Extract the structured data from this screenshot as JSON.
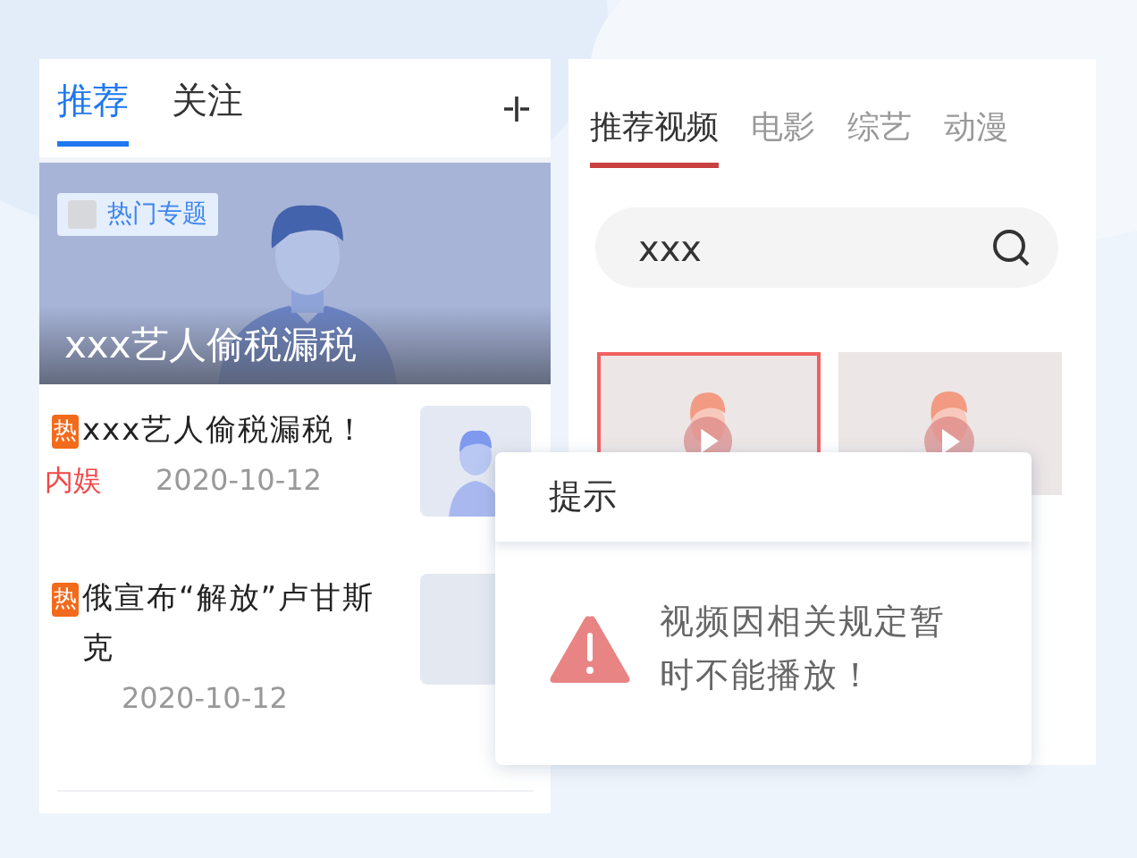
{
  "left_panel": {
    "tabs": [
      {
        "label": "推荐",
        "selected": true
      },
      {
        "label": "关注",
        "selected": false
      }
    ],
    "banner": {
      "tag": "热门专题",
      "title": "xxx艺人偷税漏税"
    },
    "news": [
      {
        "badge": "热",
        "title": "xxx艺人偷税漏税！",
        "category": "内娱",
        "date": "2020-10-12"
      },
      {
        "badge": "热",
        "title": "俄宣布“解放”卢甘斯克",
        "date": "2020-10-12",
        "thumbnail": {
          "kind": "blank"
        }
      }
    ]
  },
  "right_panel": {
    "tabs": [
      {
        "label": "推荐视频",
        "selected": true
      },
      {
        "label": "电影",
        "selected": false
      },
      {
        "label": "综艺",
        "selected": false
      },
      {
        "label": "动漫",
        "selected": false
      }
    ],
    "search": {
      "value": "xxx"
    },
    "videos": [
      {
        "selected": true
      },
      {
        "selected": false
      }
    ]
  },
  "dialog": {
    "title": "提示",
    "message": "视频因相关规定暂时不能播放！"
  }
}
